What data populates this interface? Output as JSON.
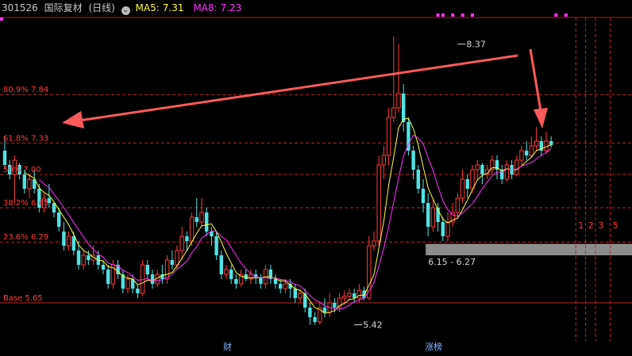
{
  "header": {
    "code": "301526",
    "name": "国际复材",
    "period": "(日线)",
    "ma5_label": "MA5:",
    "ma5_value": "7.31",
    "ma8_label": "MA8:",
    "ma8_value": "7.23"
  },
  "chart_data": {
    "type": "candlestick",
    "ylim": [
      5.25,
      8.65
    ],
    "fib_levels": [
      {
        "label": "80.9% 7.84",
        "value": 7.84
      },
      {
        "label": "61.8% 7.33",
        "value": 7.33
      },
      {
        "label": "50% 7.00",
        "value": 7.0
      },
      {
        "label": "38.2% 6.65",
        "value": 6.65
      },
      {
        "label": "23.6% 6.29",
        "value": 6.29
      },
      {
        "label": "Base 5.65",
        "value": 5.65
      }
    ],
    "price_annotations": [
      {
        "label": "8.37",
        "value": 8.37,
        "candle": 92
      },
      {
        "label": "5.42",
        "value": 5.42,
        "candle": 71
      }
    ],
    "zone": {
      "label": "6.15 - 6.27",
      "low": 6.15,
      "high": 6.27,
      "from_candle": 86
    },
    "markers": [
      {
        "label": "财",
        "candle": 45
      },
      {
        "label": "涨榜",
        "candle": 86
      }
    ],
    "right_labels": [
      {
        "label": "1",
        "candle": 117
      },
      {
        "label": "2",
        "candle": 119
      },
      {
        "label": "3",
        "candle": 121
      },
      {
        "label": "5",
        "candle": 124
      }
    ],
    "dashed_candles": [
      116,
      118,
      120,
      123
    ],
    "candles": [
      [
        7.25,
        7.1,
        7.4,
        7.05
      ],
      [
        7.1,
        7.0,
        7.15,
        6.95
      ],
      [
        7.0,
        7.15,
        7.2,
        6.7
      ],
      [
        7.1,
        7.0,
        7.12,
        6.95
      ],
      [
        7.0,
        6.85,
        7.05,
        6.8
      ],
      [
        6.85,
        6.95,
        7.0,
        6.75
      ],
      [
        6.95,
        6.85,
        7.05,
        6.8
      ],
      [
        6.85,
        6.65,
        6.9,
        6.6
      ],
      [
        6.65,
        6.75,
        6.8,
        6.6
      ],
      [
        6.75,
        6.7,
        6.9,
        6.65
      ],
      [
        6.7,
        6.6,
        6.72,
        6.55
      ],
      [
        6.6,
        6.45,
        6.65,
        6.4
      ],
      [
        6.4,
        6.25,
        6.5,
        6.2
      ],
      [
        6.25,
        6.35,
        6.4,
        6.2
      ],
      [
        6.35,
        6.2,
        6.4,
        6.15
      ],
      [
        6.2,
        6.05,
        6.3,
        6.0
      ],
      [
        6.05,
        6.15,
        6.2,
        6.0
      ],
      [
        6.15,
        6.1,
        6.2,
        6.05
      ],
      [
        6.1,
        6.15,
        6.25,
        6.05
      ],
      [
        6.15,
        6.05,
        6.2,
        6.0
      ],
      [
        6.05,
        6.0,
        6.1,
        5.95
      ],
      [
        6.0,
        5.85,
        6.05,
        5.8
      ],
      [
        5.85,
        6.05,
        6.1,
        5.8
      ],
      [
        6.05,
        5.95,
        6.1,
        5.9
      ],
      [
        5.95,
        5.8,
        6.0,
        5.75
      ],
      [
        5.8,
        5.9,
        5.95,
        5.75
      ],
      [
        5.9,
        5.8,
        5.95,
        5.75
      ],
      [
        5.8,
        5.75,
        5.85,
        5.7
      ],
      [
        5.75,
        6.05,
        6.1,
        5.72
      ],
      [
        6.05,
        5.95,
        6.1,
        5.9
      ],
      [
        5.95,
        5.85,
        6.0,
        5.8
      ],
      [
        5.85,
        5.95,
        6.0,
        5.82
      ],
      [
        5.95,
        5.9,
        6.05,
        5.85
      ],
      [
        5.9,
        6.1,
        6.15,
        5.85
      ],
      [
        6.1,
        6.05,
        6.2,
        6.0
      ],
      [
        6.05,
        6.2,
        6.25,
        6.0
      ],
      [
        6.2,
        6.35,
        6.45,
        6.1
      ],
      [
        6.35,
        6.3,
        6.4,
        6.2
      ],
      [
        6.3,
        6.55,
        6.6,
        6.25
      ],
      [
        6.55,
        6.5,
        6.75,
        6.45
      ],
      [
        6.5,
        6.6,
        6.75,
        6.45
      ],
      [
        6.6,
        6.4,
        6.65,
        6.35
      ],
      [
        6.4,
        6.35,
        6.45,
        6.25
      ],
      [
        6.35,
        6.15,
        6.4,
        6.1
      ],
      [
        6.15,
        5.95,
        6.2,
        5.9
      ],
      [
        5.95,
        6.0,
        6.05,
        5.9
      ],
      [
        6.0,
        5.9,
        6.05,
        5.85
      ],
      [
        5.9,
        5.85,
        5.95,
        5.8
      ],
      [
        5.85,
        5.95,
        6.0,
        5.82
      ],
      [
        5.95,
        5.9,
        6.0,
        5.88
      ],
      [
        5.9,
        5.95,
        6.0,
        5.85
      ],
      [
        5.95,
        5.92,
        6.0,
        5.85
      ],
      [
        5.92,
        5.85,
        5.95,
        5.8
      ],
      [
        5.85,
        6.0,
        6.05,
        5.8
      ],
      [
        6.0,
        5.9,
        6.05,
        5.85
      ],
      [
        5.9,
        5.85,
        5.95,
        5.8
      ],
      [
        5.85,
        5.8,
        5.9,
        5.75
      ],
      [
        5.8,
        5.85,
        5.9,
        5.75
      ],
      [
        5.85,
        5.8,
        5.9,
        5.7
      ],
      [
        5.8,
        5.7,
        5.85,
        5.65
      ],
      [
        5.7,
        5.75,
        5.8,
        5.65
      ],
      [
        5.75,
        5.6,
        5.8,
        5.55
      ],
      [
        5.6,
        5.5,
        5.65,
        5.42
      ],
      [
        5.5,
        5.45,
        5.55,
        5.42
      ],
      [
        5.45,
        5.6,
        5.65,
        5.42
      ],
      [
        5.6,
        5.55,
        5.7,
        5.5
      ],
      [
        5.55,
        5.65,
        5.75,
        5.5
      ],
      [
        5.65,
        5.6,
        5.7,
        5.55
      ],
      [
        5.6,
        5.7,
        5.75,
        5.55
      ],
      [
        5.7,
        5.72,
        5.78,
        5.65
      ],
      [
        5.72,
        5.75,
        5.8,
        5.68
      ],
      [
        5.75,
        5.7,
        5.8,
        5.65
      ],
      [
        5.7,
        5.78,
        5.85,
        5.65
      ],
      [
        5.78,
        5.7,
        5.82,
        5.68
      ],
      [
        5.7,
        6.25,
        6.35,
        5.68
      ],
      [
        6.25,
        6.3,
        6.4,
        6.2
      ],
      [
        6.3,
        7.1,
        7.2,
        6.25
      ],
      [
        7.1,
        7.2,
        7.3,
        6.95
      ],
      [
        7.2,
        7.6,
        7.7,
        7.1
      ],
      [
        7.6,
        7.7,
        8.45,
        7.55
      ],
      [
        7.7,
        7.85,
        8.37,
        7.65
      ],
      [
        7.85,
        7.55,
        7.95,
        7.45
      ],
      [
        7.55,
        7.25,
        7.6,
        7.2
      ],
      [
        7.25,
        7.05,
        7.3,
        6.95
      ],
      [
        7.05,
        6.85,
        7.1,
        6.8
      ],
      [
        6.85,
        6.7,
        6.95,
        6.6
      ],
      [
        6.7,
        6.45,
        6.8,
        6.35
      ],
      [
        6.45,
        6.65,
        6.75,
        6.4
      ],
      [
        6.65,
        6.5,
        6.7,
        6.4
      ],
      [
        6.5,
        6.35,
        6.55,
        6.3
      ],
      [
        6.35,
        6.5,
        6.6,
        6.3
      ],
      [
        6.5,
        6.6,
        6.7,
        6.45
      ],
      [
        6.6,
        6.75,
        6.8,
        6.55
      ],
      [
        6.75,
        6.95,
        7.05,
        6.7
      ],
      [
        6.95,
        6.85,
        7.0,
        6.75
      ],
      [
        6.85,
        7.05,
        7.1,
        6.8
      ],
      [
        7.05,
        7.1,
        7.15,
        6.95
      ],
      [
        7.1,
        7.0,
        7.12,
        6.9
      ],
      [
        7.0,
        7.05,
        7.1,
        6.95
      ],
      [
        7.05,
        7.15,
        7.2,
        7.0
      ],
      [
        7.15,
        7.05,
        7.2,
        6.95
      ],
      [
        7.05,
        6.95,
        7.1,
        6.9
      ],
      [
        6.95,
        7.1,
        7.15,
        6.92
      ],
      [
        7.1,
        7.0,
        7.15,
        6.95
      ],
      [
        7.0,
        7.15,
        7.2,
        6.98
      ],
      [
        7.15,
        7.25,
        7.3,
        7.1
      ],
      [
        7.25,
        7.2,
        7.35,
        7.15
      ],
      [
        7.2,
        7.3,
        7.4,
        7.18
      ],
      [
        7.3,
        7.35,
        7.5,
        7.25
      ],
      [
        7.35,
        7.25,
        7.4,
        7.2
      ],
      [
        7.25,
        7.35,
        7.45,
        7.22
      ],
      [
        7.35,
        7.31,
        7.4,
        7.28
      ]
    ]
  }
}
